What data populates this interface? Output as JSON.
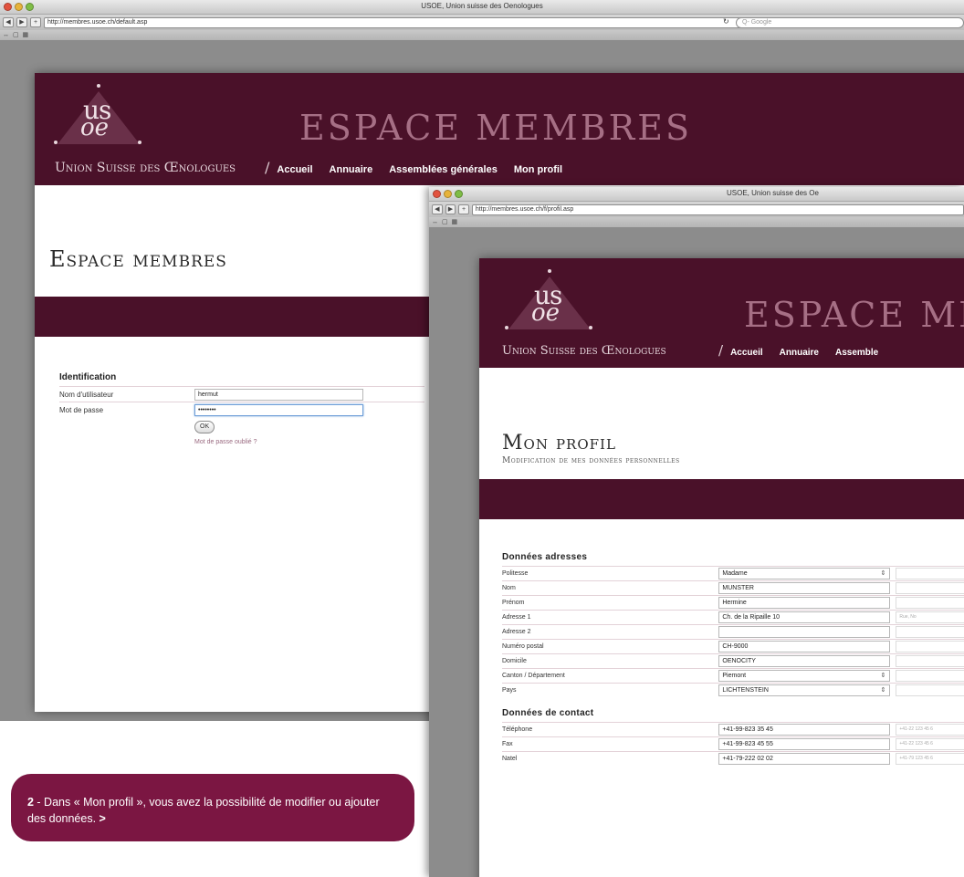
{
  "window1": {
    "title": "USOE, Union suisse des Oenologues",
    "url": "http://membres.usoe.ch/default.asp",
    "search_placeholder": "Q- Google",
    "header_title": "ESPACE MEMBRES",
    "org_name": "Union Suisse des Œnologues",
    "logo": {
      "top": "us",
      "bottom": "oe"
    },
    "nav": {
      "slash": "/",
      "items": [
        "Accueil",
        "Annuaire",
        "Assemblées générales",
        "Mon profil"
      ]
    },
    "page_title": "Espace membres",
    "login": {
      "heading": "Identification",
      "username_label": "Nom d'utilisateur",
      "username_value": "hermut",
      "password_label": "Mot de passe",
      "password_value": "••••••••",
      "ok_label": "OK",
      "forgot_label": "Mot de passe oublié ?"
    }
  },
  "window2": {
    "title": "USOE, Union suisse des Oe",
    "url": "http://membres.usoe.ch/f/profil.asp",
    "header_title": "ESPACE MEM",
    "org_name": "Union Suisse des Œnologues",
    "logo": {
      "top": "us",
      "bottom": "oe"
    },
    "nav": {
      "slash": "/",
      "items": [
        "Accueil",
        "Annuaire",
        "Assemble"
      ]
    },
    "page_title": "Mon profil",
    "page_subtitle": "Modification de mes données personnelles",
    "address": {
      "heading": "Données adresses",
      "rows": [
        {
          "label": "Politesse",
          "value": "Madame",
          "select": true,
          "ghost": ""
        },
        {
          "label": "Nom",
          "value": "MUNSTER",
          "select": false,
          "ghost": ""
        },
        {
          "label": "Prénom",
          "value": "Hermine",
          "select": false,
          "ghost": ""
        },
        {
          "label": "Adresse 1",
          "value": "Ch. de la Ripaille 10",
          "select": false,
          "ghost": "Rue, No"
        },
        {
          "label": "Adresse 2",
          "value": "",
          "select": false,
          "ghost": ""
        },
        {
          "label": "Numéro postal",
          "value": "CH-9000",
          "select": false,
          "ghost": ""
        },
        {
          "label": "Domicile",
          "value": "OENOCITY",
          "select": false,
          "ghost": ""
        },
        {
          "label": "Canton / Département",
          "value": "Piemont",
          "select": true,
          "ghost": ""
        },
        {
          "label": "Pays",
          "value": "LICHTENSTEIN",
          "select": true,
          "ghost": ""
        }
      ]
    },
    "contact": {
      "heading": "Données de contact",
      "rows": [
        {
          "label": "Téléphone",
          "value": "+41-99-823 35 45",
          "ghost": "+41-22 123 45 6"
        },
        {
          "label": "Fax",
          "value": "+41-99-823 45 55",
          "ghost": "+41-22 123 45 6"
        },
        {
          "label": "Natel",
          "value": "+41-79-222 02 02",
          "ghost": "+41-79 123 45 6"
        }
      ]
    }
  },
  "callout": {
    "number": "2",
    "text": " - Dans « Mon profil », vous avez la possibilité de modifier ou ajouter des données.",
    "arrow": " >"
  }
}
